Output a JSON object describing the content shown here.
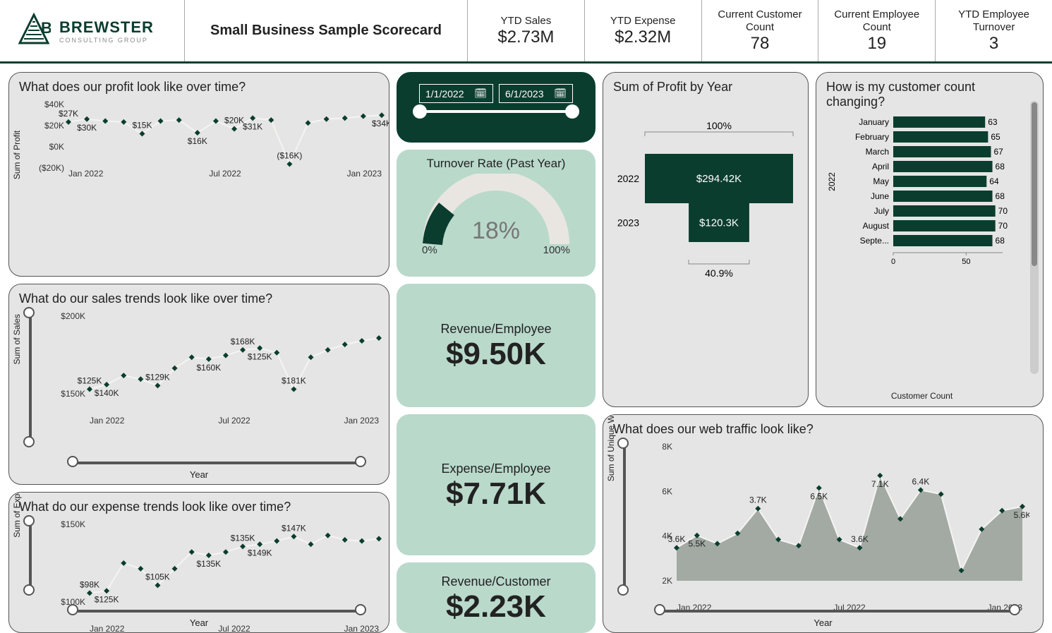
{
  "brand": {
    "name": "BREWSTER",
    "sub": "CONSULTING GROUP"
  },
  "title": "Small Business Sample Scorecard",
  "kpis": [
    {
      "label": "YTD Sales",
      "value": "$2.73M"
    },
    {
      "label": "YTD Expense",
      "value": "$2.32M"
    },
    {
      "label": "Current Customer Count",
      "value": "78"
    },
    {
      "label": "Current Employee Count",
      "value": "19"
    },
    {
      "label": "YTD Employee Turnover",
      "value": "3"
    }
  ],
  "date_slicer": {
    "from": "1/1/2022",
    "to": "6/1/2023"
  },
  "gauge": {
    "title": "Turnover Rate (Past Year)",
    "value_label": "18%",
    "min": "0%",
    "max": "100%"
  },
  "cards": {
    "rev_emp": {
      "label": "Revenue/Employee",
      "value": "$9.50K"
    },
    "exp_emp": {
      "label": "Expense/Employee",
      "value": "$7.71K"
    },
    "rev_cust": {
      "label": "Revenue/Customer",
      "value": "$2.23K"
    }
  },
  "panels": {
    "profit": {
      "title": "What does our profit look like over time?",
      "ylabel": "Sum of Profit"
    },
    "sales": {
      "title": "What do our sales trends look like over time?",
      "ylabel": "Sum of Sales",
      "xlabel": "Year"
    },
    "expense": {
      "title": "What do our expense trends look like over time?",
      "ylabel": "Sum of Expense",
      "xlabel": "Year"
    },
    "profyear": {
      "title": "Sum of Profit by Year"
    },
    "custcnt": {
      "title": "How is my customer count changing?",
      "xlabel": "Customer Count"
    },
    "web": {
      "title": "What does our web traffic look like?",
      "ylabel": "Sum of Unique Web Visitors",
      "xlabel": "Year"
    }
  },
  "chart_data": [
    {
      "id": "profit_over_time",
      "type": "line",
      "x_ticks": [
        "Jan 2022",
        "Jul 2022",
        "Jan 2023"
      ],
      "y_ticks": [
        "($20K)",
        "$0K",
        "$20K",
        "$40K"
      ],
      "data_labels": [
        "$27K",
        "$30K",
        "$15K",
        "$16K",
        "$20K",
        "$31K",
        "($16K)",
        "$34K"
      ],
      "values": [
        27,
        30,
        28,
        27,
        15,
        28,
        29,
        16,
        28,
        20,
        31,
        29,
        -16,
        26,
        30,
        31,
        33,
        34
      ],
      "ylim": [
        -20,
        45
      ]
    },
    {
      "id": "sales_over_time",
      "type": "line",
      "x_ticks": [
        "Jan 2022",
        "Jul 2022",
        "Jan 2023"
      ],
      "y_ticks": [
        "$150K",
        "$200K"
      ],
      "data_labels": [
        "$125K",
        "$140K",
        "$129K",
        "$160K",
        "$168K",
        "$125K",
        "$181K"
      ],
      "values": [
        125,
        130,
        140,
        136,
        129,
        148,
        160,
        158,
        162,
        168,
        170,
        165,
        125,
        160,
        168,
        174,
        178,
        181
      ],
      "ylim": [
        120,
        205
      ]
    },
    {
      "id": "expense_over_time",
      "type": "line",
      "x_ticks": [
        "Jan 2022",
        "Jul 2022",
        "Jan 2023"
      ],
      "y_ticks": [
        "$100K",
        "$150K"
      ],
      "data_labels": [
        "$98K",
        "$125K",
        "$105K",
        "$135K",
        "$135K",
        "$149K",
        "$147K"
      ],
      "values": [
        98,
        100,
        125,
        120,
        105,
        120,
        135,
        132,
        135,
        140,
        142,
        145,
        149,
        142,
        150,
        146,
        145,
        147
      ],
      "ylim": [
        90,
        160
      ]
    },
    {
      "id": "profit_by_year",
      "type": "bar",
      "orientation": "horizontal",
      "categories": [
        "2022",
        "2023"
      ],
      "values": [
        294.42,
        120.3
      ],
      "value_labels": [
        "$294.42K",
        "$120.3K"
      ],
      "pct_labels": [
        "100%",
        "40.9%"
      ]
    },
    {
      "id": "customer_count_by_month",
      "type": "bar",
      "orientation": "horizontal",
      "year_label": "2022",
      "categories": [
        "January",
        "February",
        "March",
        "April",
        "May",
        "June",
        "July",
        "August",
        "Septe..."
      ],
      "values": [
        63,
        65,
        67,
        68,
        64,
        68,
        70,
        70,
        68
      ],
      "x_ticks": [
        "0",
        "50"
      ]
    },
    {
      "id": "web_traffic",
      "type": "area",
      "x_ticks": [
        "Jan 2022",
        "Jul 2022",
        "Jan 2023"
      ],
      "y_ticks": [
        "2K",
        "4K",
        "6K",
        "8K"
      ],
      "data_labels": [
        "3.6K",
        "5.5K",
        "3.7K",
        "6.5K",
        "3.6K",
        "7.1K",
        "6.4K",
        "5.6K"
      ],
      "values": [
        3.6,
        4.2,
        3.8,
        4.3,
        5.5,
        4.0,
        3.7,
        6.5,
        4.0,
        3.6,
        7.1,
        5.0,
        6.4,
        6.2,
        2.5,
        4.5,
        5.4,
        5.6
      ],
      "ylim": [
        2,
        8.5
      ]
    }
  ]
}
